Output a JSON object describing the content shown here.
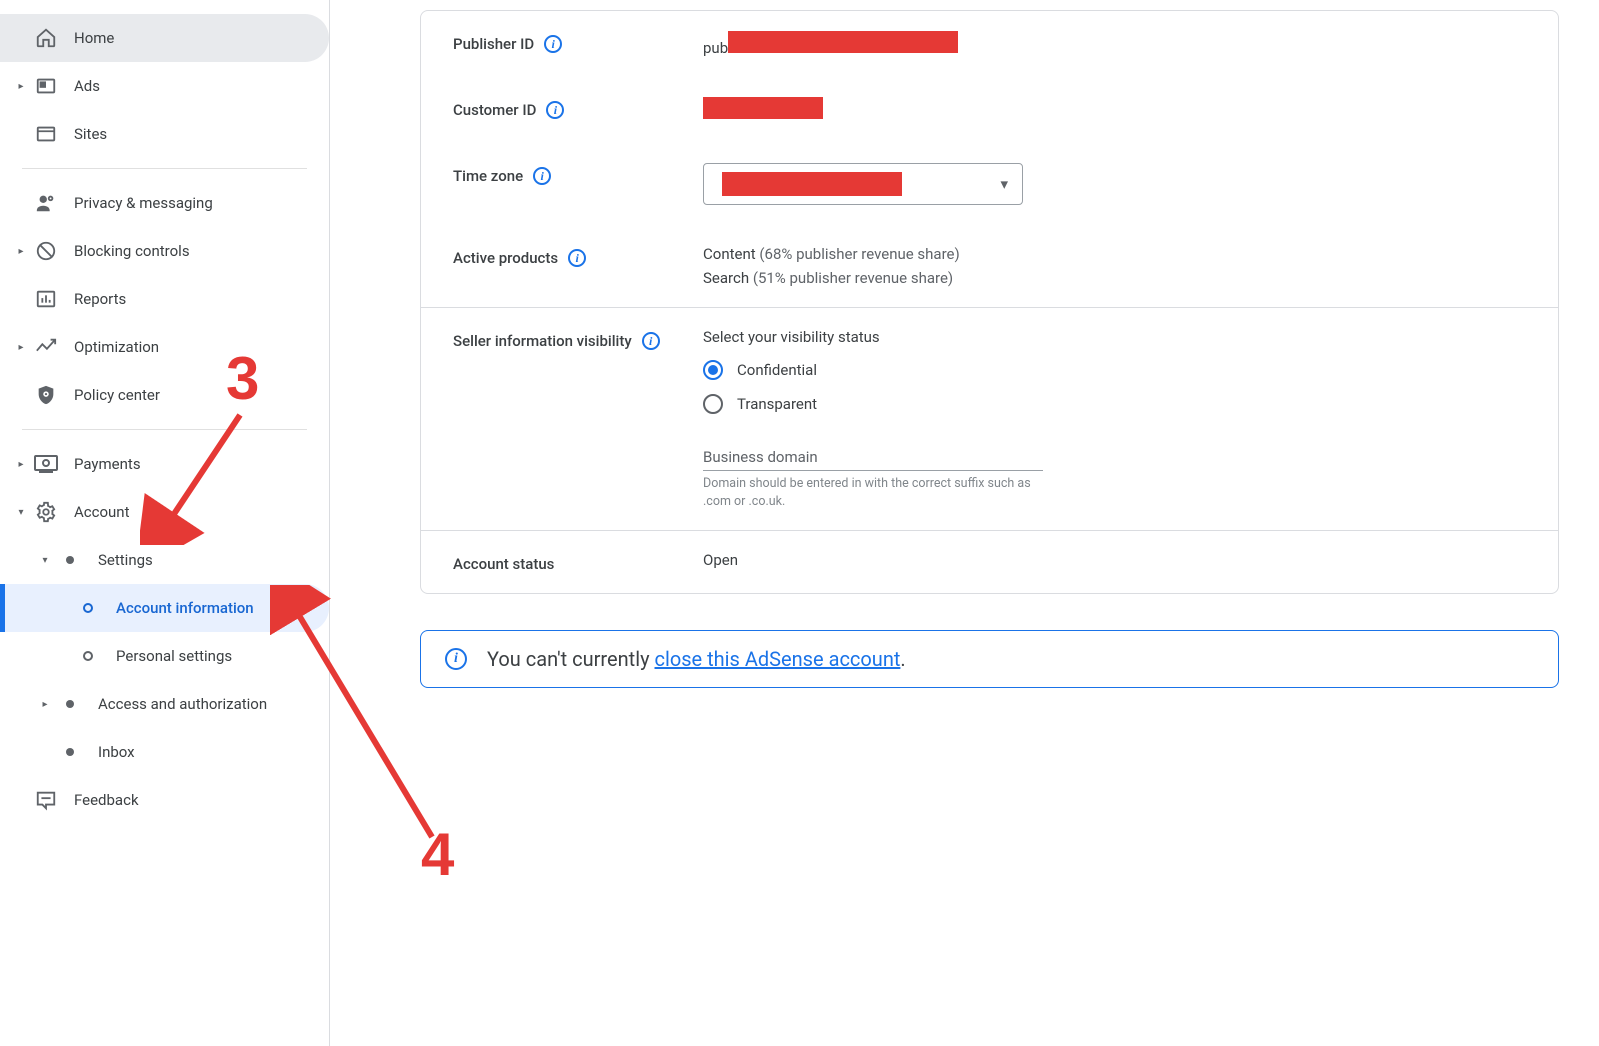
{
  "sidebar": {
    "home": "Home",
    "ads": "Ads",
    "sites": "Sites",
    "privacy": "Privacy & messaging",
    "blocking": "Blocking controls",
    "reports": "Reports",
    "optimization": "Optimization",
    "policy": "Policy center",
    "payments": "Payments",
    "account": "Account",
    "settings": "Settings",
    "account_info": "Account information",
    "personal": "Personal settings",
    "access_auth": "Access and authorization",
    "inbox": "Inbox",
    "feedback": "Feedback"
  },
  "main": {
    "publisher_id_label": "Publisher ID",
    "publisher_id_prefix": "pub",
    "customer_id_label": "Customer ID",
    "timezone_label": "Time zone",
    "active_products_label": "Active products",
    "active_products": {
      "content_name": "Content",
      "content_share": "(68% publisher revenue share)",
      "search_name": "Search",
      "search_share": "(51% publisher revenue share)"
    },
    "seller_visibility_label": "Seller information visibility",
    "select_visibility": "Select your visibility status",
    "radio_confidential": "Confidential",
    "radio_transparent": "Transparent",
    "business_domain": "Business domain",
    "business_domain_hint": "Domain should be entered in with the correct suffix such as .com or .co.uk.",
    "account_status_label": "Account status",
    "account_status_value": "Open",
    "alert_text_prefix": "You can't currently ",
    "alert_link": "close this AdSense account",
    "alert_text_suffix": "."
  },
  "annotations": {
    "num3": "3",
    "num4": "4"
  }
}
